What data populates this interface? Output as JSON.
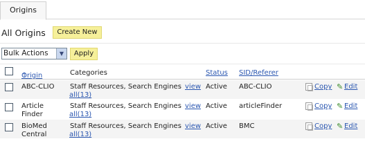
{
  "tabs": [
    {
      "label": "Origins"
    }
  ],
  "page": {
    "title": "All Origins",
    "create_label": "Create New"
  },
  "bulk": {
    "selected": "Bulk Actions",
    "apply_label": "Apply"
  },
  "table": {
    "headers": {
      "origin": "Origin",
      "sort_arrow": "↑",
      "categories": "Categories",
      "status": "Status",
      "sid": "SID/Referer"
    },
    "rows": [
      {
        "origin": [
          "ABC-CLIO",
          ""
        ],
        "categories": "Staff Resources, Search Engines",
        "view_label": [
          "view",
          "all(13)"
        ],
        "status": "Active",
        "sid": "ABC-CLIO",
        "copy": "Copy",
        "edit": "Edit"
      },
      {
        "origin": [
          "Article",
          "Finder"
        ],
        "categories": "Staff Resources, Search Engines",
        "view_label": [
          "view",
          "all(13)"
        ],
        "status": "Active",
        "sid": "articleFinder",
        "copy": "Copy",
        "edit": "Edit"
      },
      {
        "origin": [
          "BioMed",
          "Central"
        ],
        "categories": "Staff Resources, Search Engines",
        "view_label": [
          "view",
          "all(13)"
        ],
        "status": "Active",
        "sid": "BMC",
        "copy": "Copy",
        "edit": "Edit"
      }
    ]
  }
}
